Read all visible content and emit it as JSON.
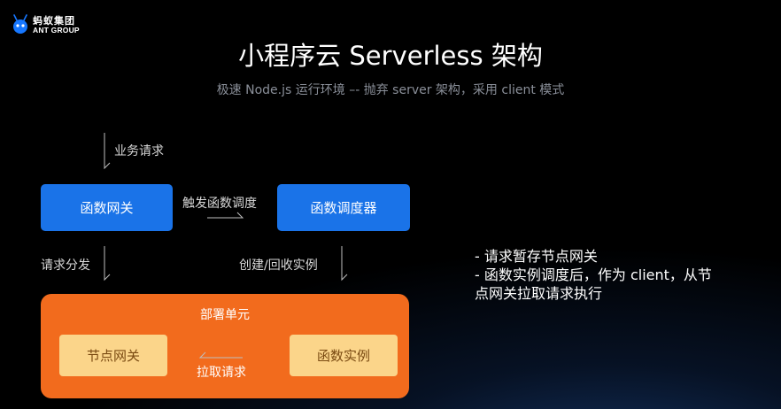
{
  "logo": {
    "icon": "ant-icon",
    "name_cn": "蚂蚁集团",
    "name_en": "ANT GROUP"
  },
  "title": "小程序云 Serverless 架构",
  "subtitle": "极速 Node.js 运行环境 –- 抛弃 server 架构，采用 client 模式",
  "diagram": {
    "label_business_request": "业务请求",
    "gateway": "函数网关",
    "label_trigger_schedule": "触发函数调度",
    "scheduler": "函数调度器",
    "label_request_dispatch": "请求分发",
    "label_create_recycle": "创建/回收实例",
    "deploy_unit": {
      "title": "部署单元",
      "node_gateway": "节点网关",
      "function_instance": "函数实例",
      "label_pull_request": "拉取请求"
    }
  },
  "notes": [
    "- 请求暂存节点网关",
    "- 函数实例调度后，作为 client，从节",
    "点网关拉取请求执行"
  ],
  "colors": {
    "background": "#000000",
    "blue_box": "#1a73e8",
    "deploy_unit": "#f26b1d",
    "cream_box": "#fbd58a",
    "subtitle": "#8a8f99"
  }
}
